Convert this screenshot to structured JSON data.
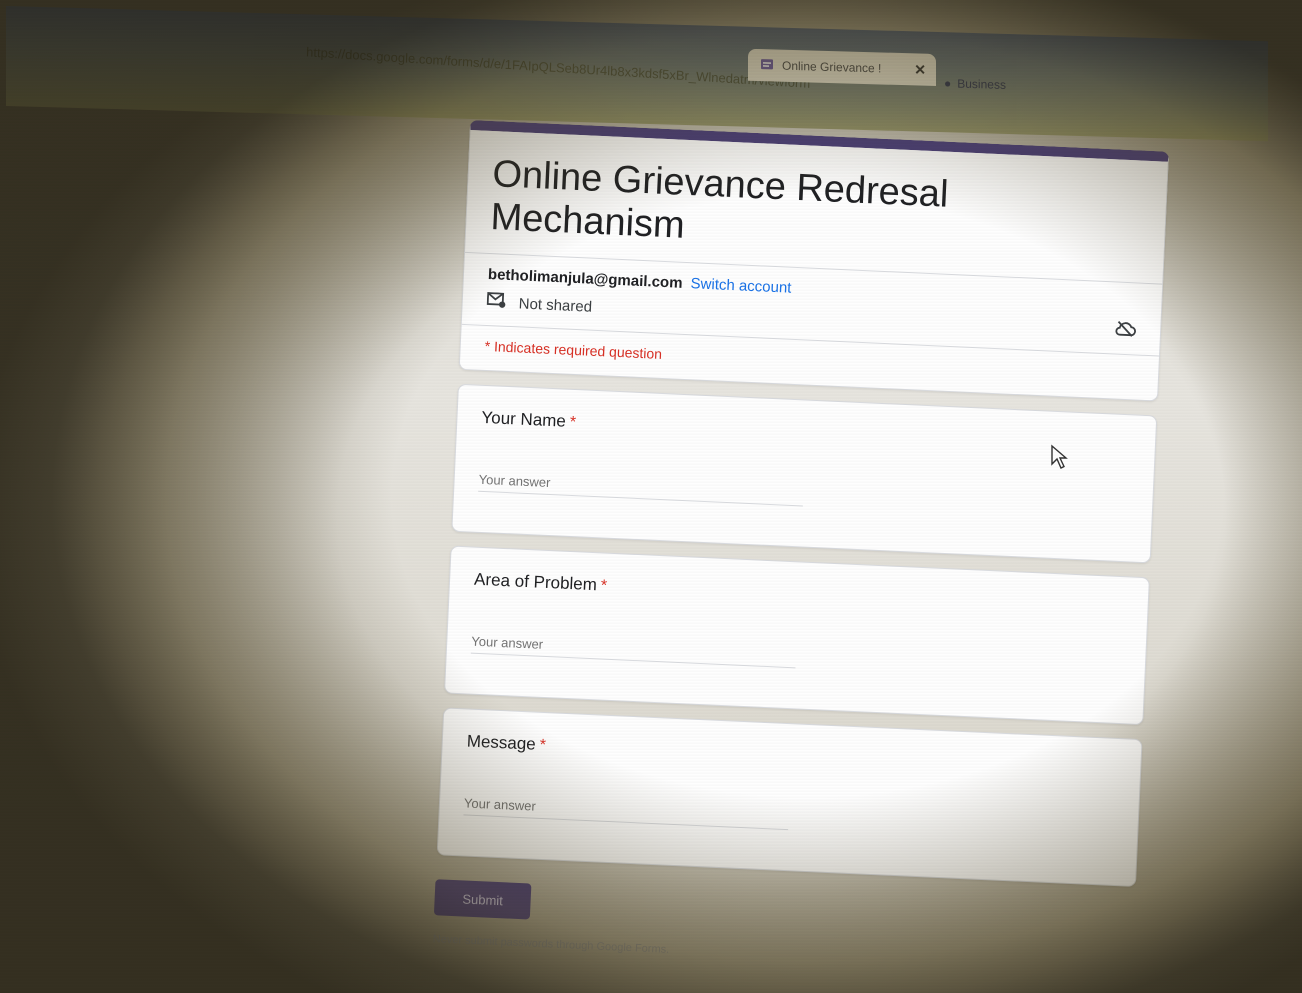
{
  "browser": {
    "tab_title": "Online Grievance !",
    "tab_close": "✕",
    "tab2_title": "Business",
    "url": "https://docs.google.com/forms/d/e/1FAIpQLSeb8Ur4lb8x3kdsf5xBr_Wlnedatm/viewform"
  },
  "form": {
    "title": "Online Grievance Redresal Mechanism",
    "account_email": "betholimanjula@gmail.com",
    "switch_account": "Switch account",
    "not_shared": "Not shared",
    "required_note": "* Indicates required question",
    "questions": [
      {
        "label": "Your Name",
        "required_mark": "*",
        "placeholder": "Your answer"
      },
      {
        "label": "Area of Problem",
        "required_mark": "*",
        "placeholder": "Your answer"
      },
      {
        "label": "Message",
        "required_mark": "*",
        "placeholder": "Your answer"
      }
    ],
    "submit_label": "Submit",
    "footer": "Never submit passwords through Google Forms."
  },
  "colors": {
    "accent": "#4a3e7a",
    "required": "#d93025",
    "link": "#1a73e8"
  },
  "icons": {
    "tab": "form-icon",
    "shared": "mail-icon",
    "cloud": "cloud-off-icon",
    "cursor": "mouse-cursor-icon"
  }
}
